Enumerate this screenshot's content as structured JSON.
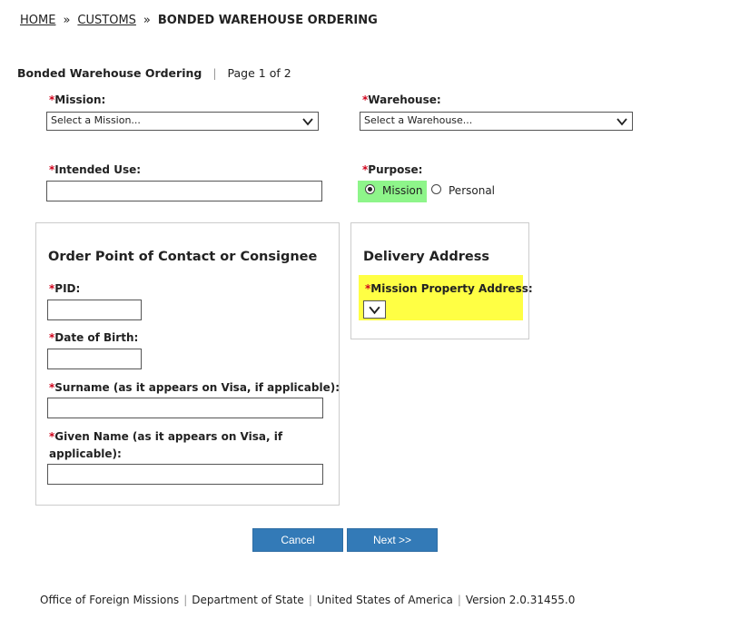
{
  "breadcrumb": {
    "home": "HOME",
    "customs": "CUSTOMS",
    "current": "BONDED WAREHOUSE ORDERING",
    "separator": "»"
  },
  "page_header": {
    "title": "Bonded Warehouse Ordering",
    "pipe": "|",
    "page_info": "Page 1 of 2"
  },
  "required_marker": "*",
  "mission": {
    "label": "Mission:",
    "value": "Select a Mission..."
  },
  "warehouse": {
    "label": "Warehouse:",
    "value": "Select a Warehouse..."
  },
  "intended_use": {
    "label": "Intended Use:",
    "value": ""
  },
  "purpose": {
    "label": "Purpose:",
    "options": [
      {
        "label": "Mission",
        "selected": true
      },
      {
        "label": "Personal",
        "selected": false
      }
    ]
  },
  "contact_panel": {
    "title": "Order Point of Contact or Consignee",
    "pid_label": "PID:",
    "dob_label": "Date of Birth:",
    "surname_label": "Surname (as it appears on Visa, if applicable):",
    "given_name_label_line1": "Given Name (as it appears on Visa, if",
    "given_name_label_line2": "applicable):"
  },
  "delivery_panel": {
    "title": "Delivery Address",
    "mission_property_label": "Mission Property Address:"
  },
  "buttons": {
    "cancel": "Cancel",
    "next": "Next >>"
  },
  "footer": {
    "items": [
      "Office of Foreign Missions",
      "Department of State",
      "United States of America",
      "Version 2.0.31455.0"
    ],
    "separator": "|"
  },
  "colors": {
    "primary_button": "#337ab7",
    "required": "#d0021b",
    "highlight_green": "#8ef58a",
    "highlight_yellow": "#ffff44"
  },
  "icons": [
    "chevron-down-icon",
    "radio-selected-icon",
    "radio-unselected-icon"
  ]
}
